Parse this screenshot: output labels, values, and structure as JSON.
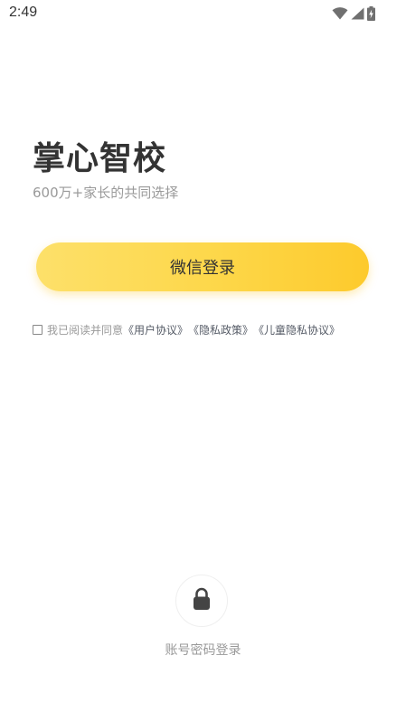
{
  "status_bar": {
    "time": "2:49",
    "icons": [
      "wifi-icon",
      "signal-icon",
      "battery-charging-icon"
    ]
  },
  "header": {
    "title": "掌心智校",
    "subtitle": "600万+家长的共同选择"
  },
  "wechat_login": {
    "label": "微信登录",
    "gradient_colors": [
      "#fde06a",
      "#fdca2c"
    ]
  },
  "agreement": {
    "checked": false,
    "text": "我已阅读并同意",
    "links": [
      "《用户协议》",
      "《隐私政策》",
      "《儿童隐私协议》"
    ]
  },
  "password_login": {
    "icon": "lock-icon",
    "label": "账号密码登录"
  }
}
